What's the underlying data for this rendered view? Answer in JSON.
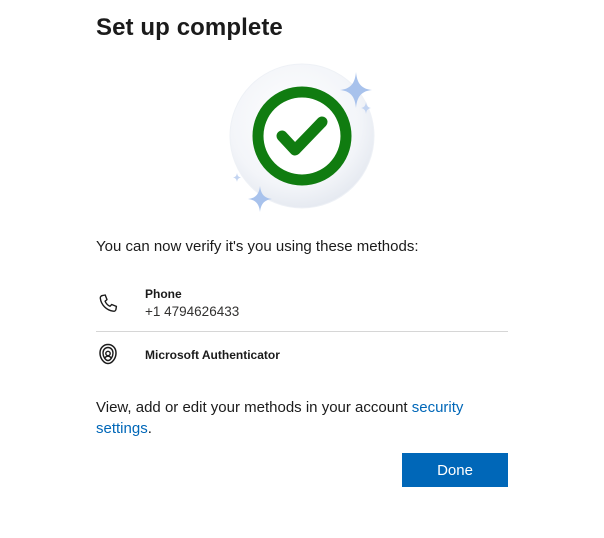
{
  "header": {
    "title": "Set up complete"
  },
  "illustration": {
    "icon": "success-checkmark-icon",
    "sparkle_color": "#a8c2ec",
    "check_color": "#107c10"
  },
  "content": {
    "intro": "You can now verify it's you using these methods:",
    "methods": [
      {
        "name": "Phone",
        "detail": "+1 4794626433",
        "icon": "phone-icon"
      },
      {
        "name": "Microsoft Authenticator",
        "icon": "authenticator-icon"
      }
    ],
    "footer_prefix": "View, add or edit your methods in your account ",
    "footer_link": "security settings",
    "footer_suffix": "."
  },
  "actions": {
    "done_label": "Done",
    "accent_color": "#0067b8"
  }
}
